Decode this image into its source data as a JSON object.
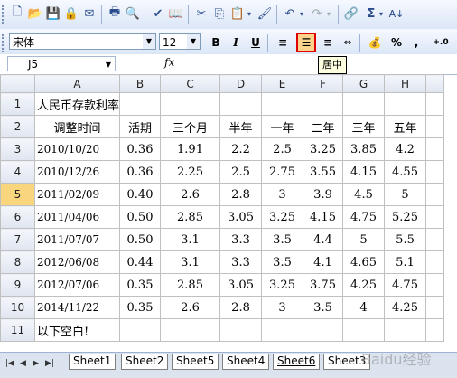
{
  "formatting": {
    "font_name": "宋体",
    "font_size": "12",
    "bold": "B",
    "italic": "I",
    "underline": "U",
    "percent": "%",
    "comma": ",",
    "decimal": "+.0"
  },
  "formula_bar": {
    "name_box": "J5",
    "fx": "fx"
  },
  "tooltip": "居中",
  "columns": [
    "A",
    "B",
    "C",
    "D",
    "E",
    "F",
    "G",
    "H"
  ],
  "rows": [
    {
      "num": "1",
      "cells": [
        "人民币存款利率",
        "",
        "",
        "",
        "",
        "",
        "",
        ""
      ]
    },
    {
      "num": "2",
      "cells": [
        "调整时间",
        "活期",
        "三个月",
        "半年",
        "一年",
        "二年",
        "三年",
        "五年"
      ]
    },
    {
      "num": "3",
      "cells": [
        "2010/10/20",
        "0.36",
        "1.91",
        "2.2",
        "2.5",
        "3.25",
        "3.85",
        "4.2"
      ]
    },
    {
      "num": "4",
      "cells": [
        "2010/12/26",
        "0.36",
        "2.25",
        "2.5",
        "2.75",
        "3.55",
        "4.15",
        "4.55"
      ]
    },
    {
      "num": "5",
      "cells": [
        "2011/02/09",
        "0.40",
        "2.6",
        "2.8",
        "3",
        "3.9",
        "4.5",
        "5"
      ]
    },
    {
      "num": "6",
      "cells": [
        "2011/04/06",
        "0.50",
        "2.85",
        "3.05",
        "3.25",
        "4.15",
        "4.75",
        "5.25"
      ]
    },
    {
      "num": "7",
      "cells": [
        "2011/07/07",
        "0.50",
        "3.1",
        "3.3",
        "3.5",
        "4.4",
        "5",
        "5.5"
      ]
    },
    {
      "num": "8",
      "cells": [
        "2012/06/08",
        "0.44",
        "3.1",
        "3.3",
        "3.5",
        "4.1",
        "4.65",
        "5.1"
      ]
    },
    {
      "num": "9",
      "cells": [
        "2012/07/06",
        "0.35",
        "2.85",
        "3.05",
        "3.25",
        "3.75",
        "4.25",
        "4.75"
      ]
    },
    {
      "num": "10",
      "cells": [
        "2014/11/22",
        "0.35",
        "2.6",
        "2.8",
        "3",
        "3.5",
        "4",
        "4.25"
      ]
    },
    {
      "num": "11",
      "cells": [
        "以下空白!",
        "",
        "",
        "",
        "",
        "",
        "",
        ""
      ]
    }
  ],
  "sheet_tabs": [
    "Sheet1",
    "Sheet2",
    "Sheet5",
    "Sheet4",
    "Sheet6",
    "Sheet3"
  ],
  "active_sheet": "Sheet6",
  "watermark": "Baidu经验"
}
